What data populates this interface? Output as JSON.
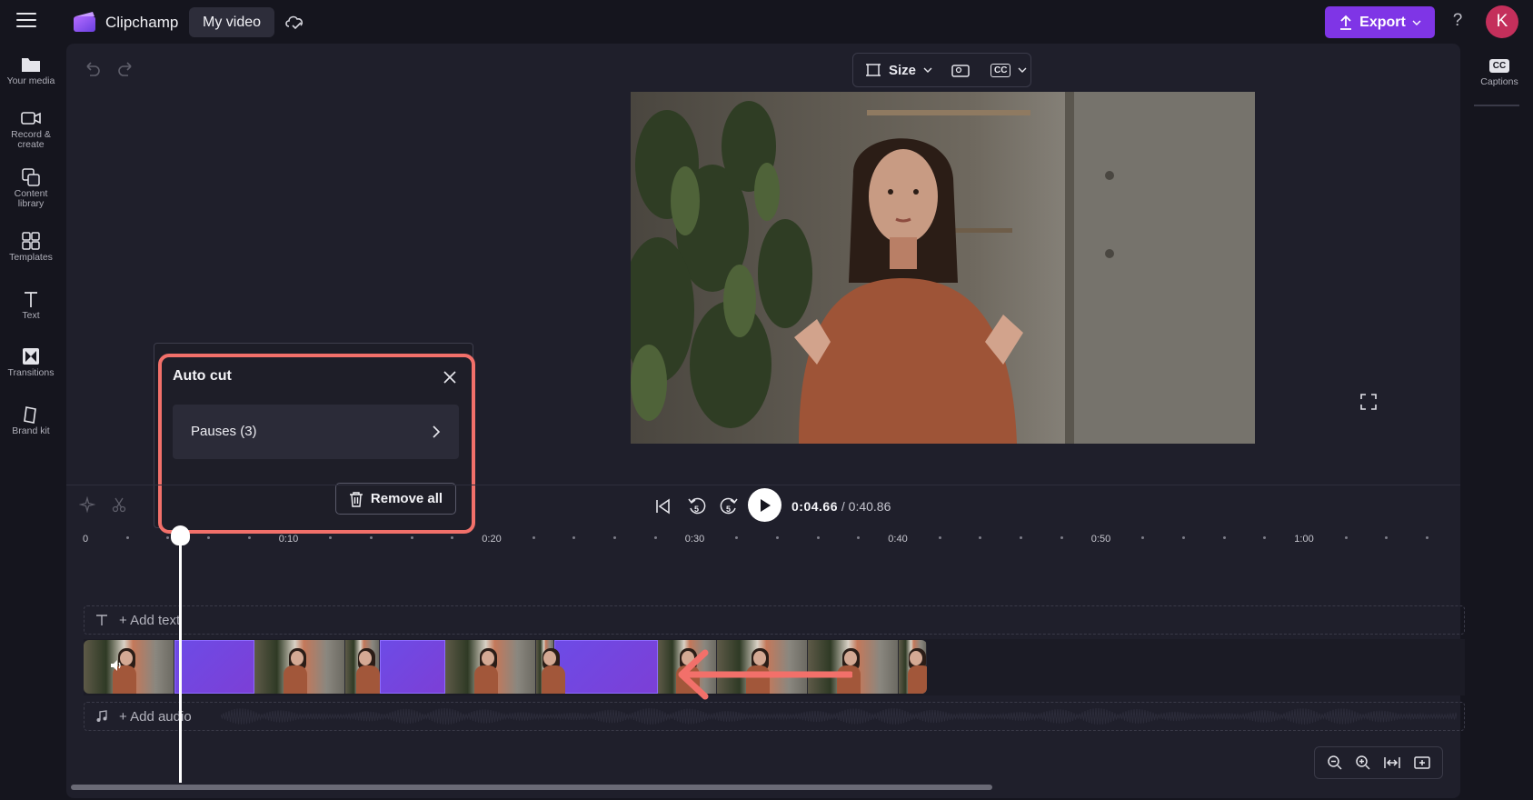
{
  "app": {
    "name": "Clipchamp",
    "project_title": "My video",
    "export_label": "Export",
    "help_label": "?",
    "avatar_initial": "K",
    "accent_color": "#7f35e6"
  },
  "sidebar": {
    "items": [
      {
        "label": "Your media",
        "icon": "folder-icon"
      },
      {
        "label": "Record &\ncreate",
        "icon": "camera-icon"
      },
      {
        "label": "Content\nlibrary",
        "icon": "library-icon"
      },
      {
        "label": "Templates",
        "icon": "templates-icon"
      },
      {
        "label": "Text",
        "icon": "text-icon"
      },
      {
        "label": "Transitions",
        "icon": "transitions-icon"
      },
      {
        "label": "Brand kit",
        "icon": "brand-kit-icon"
      }
    ]
  },
  "right_panel": {
    "captions_label": "Captions",
    "captions_badge": "CC"
  },
  "preview": {
    "size_label": "Size",
    "cc_badge": "CC"
  },
  "auto_cut": {
    "title": "Auto cut",
    "pauses_label": "Pauses (3)",
    "remove_all_label": "Remove all",
    "highlight_color": "#f2706a"
  },
  "playback": {
    "current_time": "0:04.66",
    "total_time": "/ 0:40.86",
    "rewind_seconds": "5",
    "forward_seconds": "5"
  },
  "ruler": {
    "labels": [
      "0",
      "0:10",
      "0:20",
      "0:30",
      "0:40",
      "0:50",
      "1:00"
    ]
  },
  "tracks": {
    "text_track_label": "+ Add text",
    "audio_track_label": "+ Add audio"
  },
  "timeline": {
    "pause_count": 3,
    "pause_color": "#6d4be6"
  }
}
